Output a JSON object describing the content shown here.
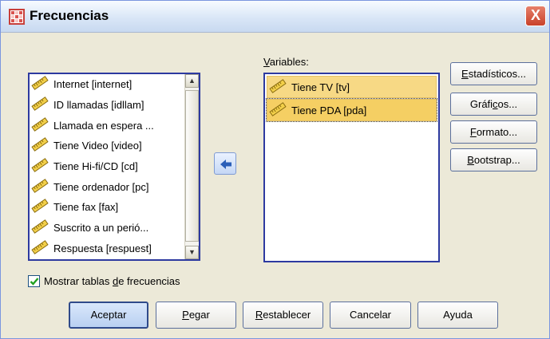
{
  "window": {
    "title": "Frecuencias",
    "close_label": "X",
    "icons": {
      "app": "spss-table-icon",
      "close": "close-icon"
    }
  },
  "source_list": {
    "items": [
      {
        "label": "Internet [internet]",
        "icon": "scale-ruler-icon"
      },
      {
        "label": "ID llamadas [idllam]",
        "icon": "scale-ruler-icon"
      },
      {
        "label": "Llamada en espera ...",
        "icon": "scale-ruler-icon"
      },
      {
        "label": "Tiene Video [video]",
        "icon": "scale-ruler-icon"
      },
      {
        "label": "Tiene Hi-fi/CD [cd]",
        "icon": "scale-ruler-icon"
      },
      {
        "label": "Tiene ordenador [pc]",
        "icon": "scale-ruler-icon"
      },
      {
        "label": "Tiene fax [fax]",
        "icon": "scale-ruler-icon"
      },
      {
        "label": "Suscrito a un perió...",
        "icon": "scale-ruler-icon"
      },
      {
        "label": "Respuesta [respuest]",
        "icon": "scale-ruler-icon"
      }
    ]
  },
  "move_button": {
    "icon": "left-arrow-icon"
  },
  "variables": {
    "label_pre": "",
    "label_mn": "V",
    "label_post": "ariables:",
    "items": [
      {
        "label": "Tiene TV [tv]",
        "icon": "scale-ruler-icon"
      },
      {
        "label": "Tiene PDA [pda]",
        "icon": "scale-ruler-icon"
      }
    ]
  },
  "side_buttons": [
    {
      "pre": "",
      "mn": "E",
      "post": "stadísticos..."
    },
    {
      "pre": "Gráfi",
      "mn": "c",
      "post": "os..."
    },
    {
      "pre": "",
      "mn": "F",
      "post": "ormato..."
    },
    {
      "pre": "",
      "mn": "B",
      "post": "ootstrap..."
    }
  ],
  "show_tables": {
    "checked": true,
    "pre": "Mostrar tablas ",
    "mn": "d",
    "post": "e frecuencias"
  },
  "bottom_buttons": [
    {
      "pre": "Aceptar",
      "mn": "",
      "post": ""
    },
    {
      "pre": "",
      "mn": "P",
      "post": "egar"
    },
    {
      "pre": "",
      "mn": "R",
      "post": "establecer"
    },
    {
      "pre": "Cancelar",
      "mn": "",
      "post": ""
    },
    {
      "pre": "Ayuda",
      "mn": "",
      "post": ""
    }
  ]
}
